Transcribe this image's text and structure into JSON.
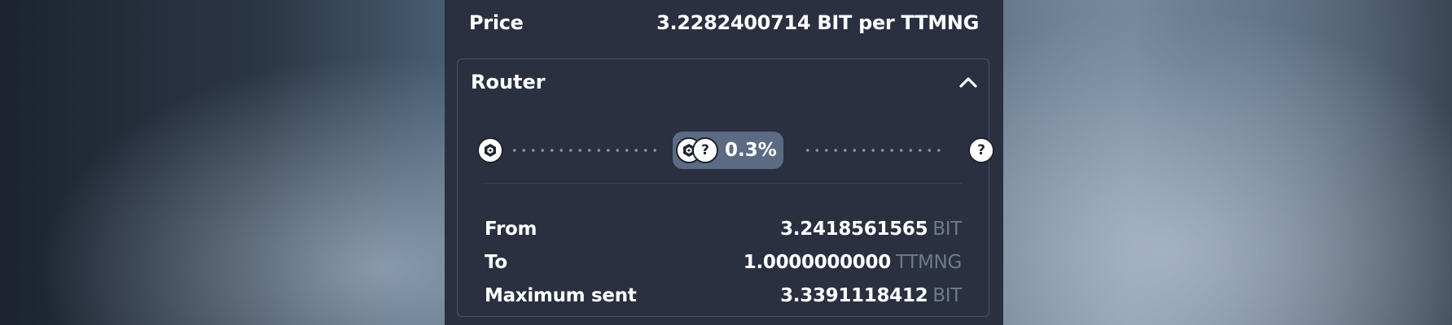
{
  "price": {
    "label": "Price",
    "value": "3.2282400714 BIT per TTMNG"
  },
  "router": {
    "title": "Router",
    "toggle_icon": "chevron-up-icon",
    "route": {
      "start_token_icon": "hexagon-token-icon",
      "pool_icons": [
        "hexagon-token-icon",
        "unknown-token-icon"
      ],
      "pool_fee": "0.3%",
      "end_token_icon": "unknown-token-icon",
      "unknown_glyph": "?"
    },
    "details": [
      {
        "label": "From",
        "value": "3.2418561565",
        "unit": "BIT"
      },
      {
        "label": "To",
        "value": "1.0000000000",
        "unit": "TTMNG"
      },
      {
        "label": "Maximum sent",
        "value": "3.3391118412",
        "unit": "BIT"
      }
    ]
  },
  "colors": {
    "panel_bg": "#2a3040",
    "border": "#48536a",
    "pill_bg": "#5b6b84",
    "muted_unit": "#6f7a8e"
  }
}
